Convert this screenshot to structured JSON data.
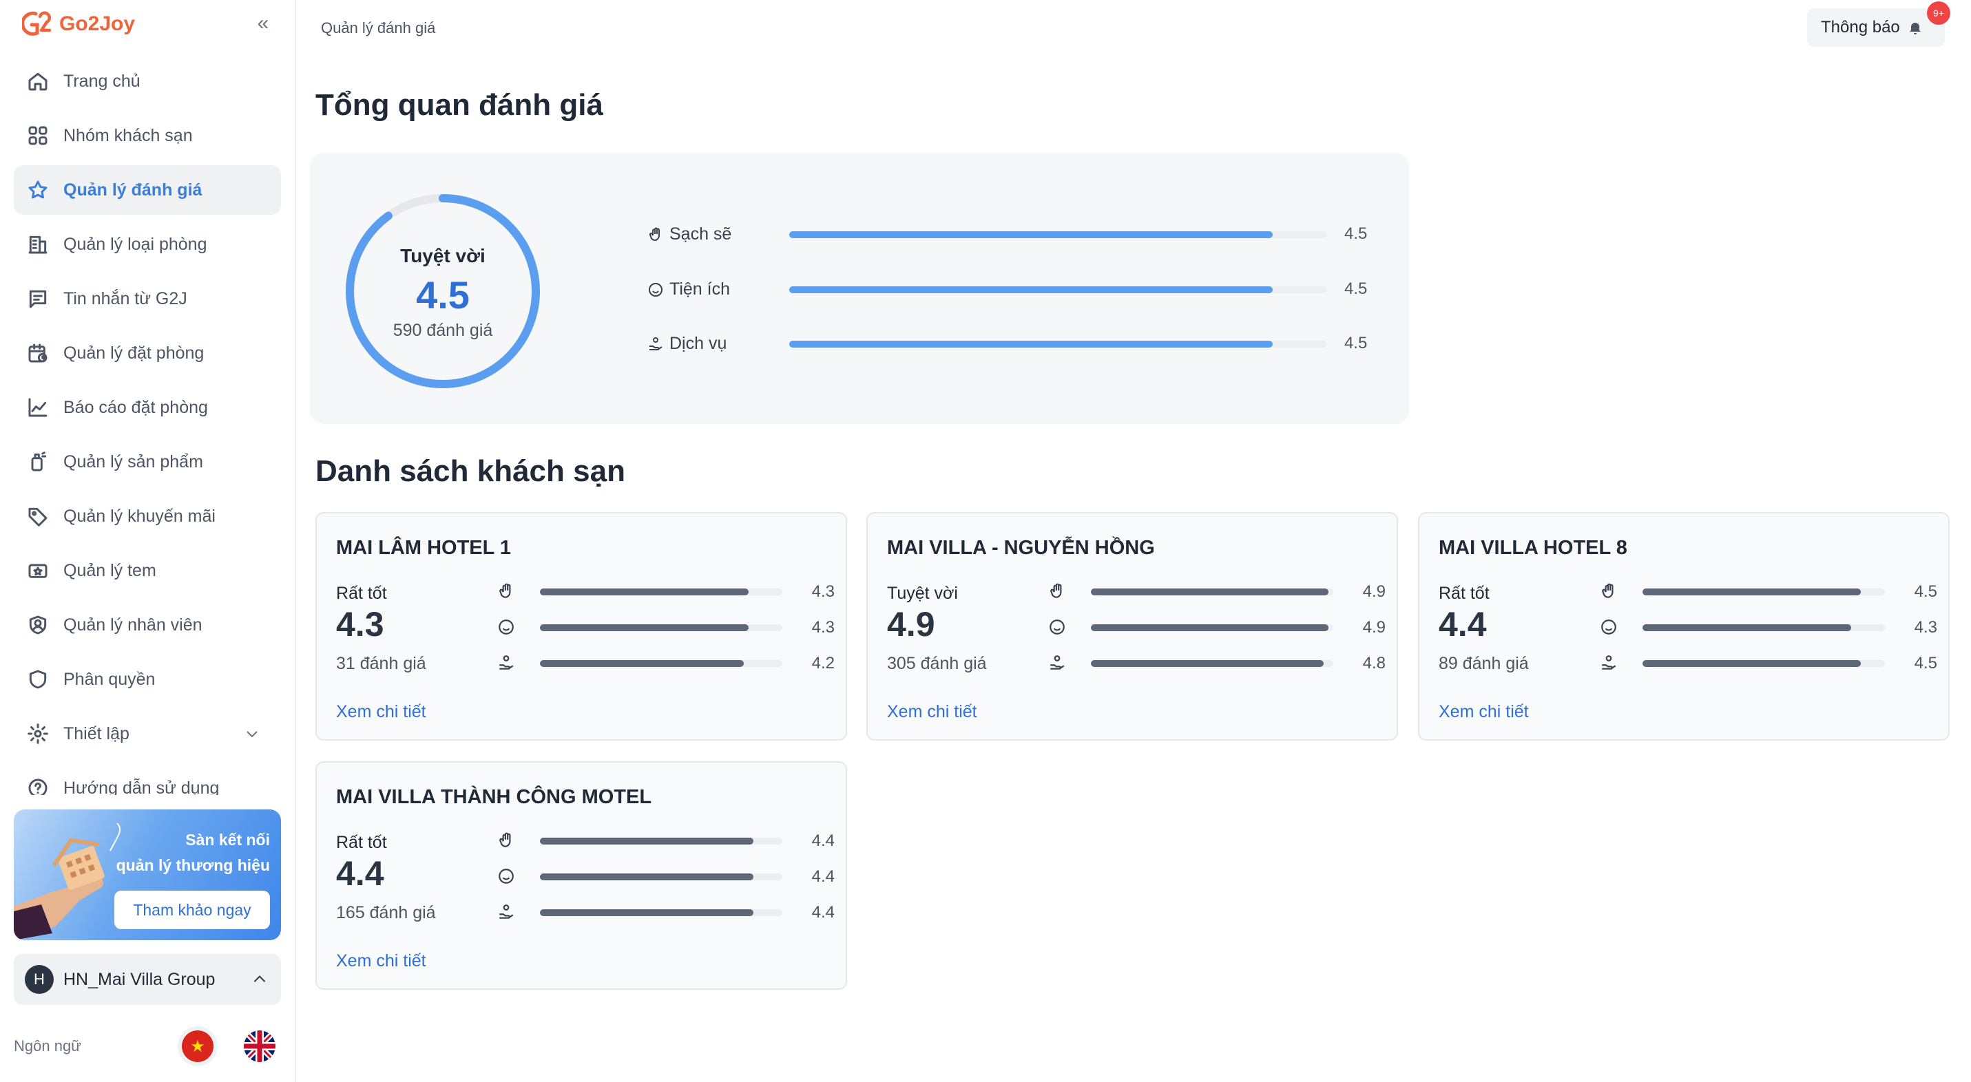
{
  "brand": {
    "name": "Go2Joy",
    "color": "#f0643c"
  },
  "sidebar": {
    "items": [
      {
        "label": "Trang chủ",
        "icon": "home-icon",
        "active": false
      },
      {
        "label": "Nhóm khách sạn",
        "icon": "grid-icon",
        "active": false
      },
      {
        "label": "Quản lý đánh giá",
        "icon": "star-icon",
        "active": true
      },
      {
        "label": "Quản lý loại phòng",
        "icon": "building-icon",
        "active": false
      },
      {
        "label": "Tin nhắn từ G2J",
        "icon": "message-icon",
        "active": false
      },
      {
        "label": "Quản lý đặt phòng",
        "icon": "calendar-icon",
        "active": false
      },
      {
        "label": "Báo cáo đặt phòng",
        "icon": "chart-line-icon",
        "active": false
      },
      {
        "label": "Quản lý sản phẩm",
        "icon": "bottle-icon",
        "active": false
      },
      {
        "label": "Quản lý khuyến mãi",
        "icon": "tag-icon",
        "active": false
      },
      {
        "label": "Quản lý tem",
        "icon": "ticket-icon",
        "active": false
      },
      {
        "label": "Quản lý nhân viên",
        "icon": "user-circle-icon",
        "active": false
      },
      {
        "label": "Phân quyền",
        "icon": "shield-icon",
        "active": false
      },
      {
        "label": "Thiết lập",
        "icon": "gear-icon",
        "active": false
      },
      {
        "label": "Hướng dẫn sử dụng",
        "icon": "help-icon",
        "active": false
      }
    ],
    "promo": {
      "line1": "Sàn kết nối",
      "line2": "quản lý thương hiệu",
      "button": "Tham khảo ngay"
    },
    "group": {
      "avatar": "H",
      "name": "HN_Mai Villa Group"
    },
    "language_label": "Ngôn ngữ"
  },
  "header": {
    "breadcrumb": "Quản lý đánh giá",
    "notification_label": "Thông báo",
    "notification_badge": "9+"
  },
  "overview": {
    "title": "Tổng quan đánh giá",
    "level": "Tuyệt vời",
    "score": "4.5",
    "score_fraction": 0.9,
    "count": "590 đánh giá",
    "criteria": [
      {
        "label": "Sạch sẽ",
        "icon": "hand-wave-icon",
        "value": "4.5",
        "fraction": 0.9
      },
      {
        "label": "Tiện ích",
        "icon": "smile-icon",
        "value": "4.5",
        "fraction": 0.9
      },
      {
        "label": "Dịch vụ",
        "icon": "service-hand-icon",
        "value": "4.5",
        "fraction": 0.9
      }
    ]
  },
  "hotels": {
    "title": "Danh sách khách sạn",
    "link_label": "Xem chi tiết",
    "items": [
      {
        "name": "MAI LÂM HOTEL 1",
        "level": "Rất tốt",
        "score": "4.3",
        "count": "31 đánh giá",
        "criteria": [
          {
            "value": "4.3",
            "fraction": 0.86
          },
          {
            "value": "4.3",
            "fraction": 0.86
          },
          {
            "value": "4.2",
            "fraction": 0.84
          }
        ]
      },
      {
        "name": "MAI VILLA - NGUYỄN HỒNG",
        "level": "Tuyệt vời",
        "score": "4.9",
        "count": "305 đánh giá",
        "criteria": [
          {
            "value": "4.9",
            "fraction": 0.98
          },
          {
            "value": "4.9",
            "fraction": 0.98
          },
          {
            "value": "4.8",
            "fraction": 0.96
          }
        ]
      },
      {
        "name": "MAI VILLA HOTEL 8",
        "level": "Rất tốt",
        "score": "4.4",
        "count": "89 đánh giá",
        "criteria": [
          {
            "value": "4.5",
            "fraction": 0.9
          },
          {
            "value": "4.3",
            "fraction": 0.86
          },
          {
            "value": "4.5",
            "fraction": 0.9
          }
        ]
      },
      {
        "name": "MAI VILLA THÀNH CÔNG MOTEL",
        "level": "Rất tốt",
        "score": "4.4",
        "count": "165 đánh giá",
        "criteria": [
          {
            "value": "4.4",
            "fraction": 0.88
          },
          {
            "value": "4.4",
            "fraction": 0.88
          },
          {
            "value": "4.4",
            "fraction": 0.88
          }
        ]
      }
    ]
  },
  "colors": {
    "accent": "#2f6fd6",
    "ring": "#5b9ef0",
    "bar_dark": "#5d6778"
  }
}
